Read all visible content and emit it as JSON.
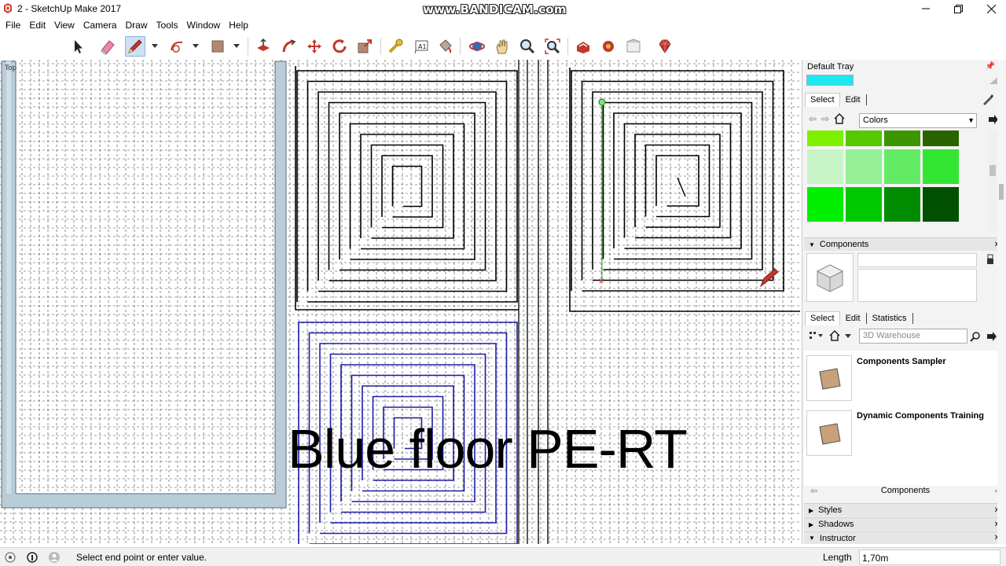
{
  "window": {
    "title": "2 - SketchUp Make 2017",
    "watermark": "www.BANDICAM.com",
    "app_icon": "sketchup-logo-icon",
    "controls": [
      "minimize-icon",
      "restore-icon",
      "close-icon"
    ]
  },
  "menu": {
    "items": [
      "File",
      "Edit",
      "View",
      "Camera",
      "Draw",
      "Tools",
      "Window",
      "Help"
    ]
  },
  "toolbar": {
    "tools": [
      "select-arrow-icon",
      "eraser-icon",
      "pencil-line-icon",
      "arc-icon",
      "rectangle-icon",
      "push-pull-icon",
      "follow-me-icon",
      "move-icon",
      "rotate-icon",
      "scale-icon",
      "tape-measure-icon",
      "text-icon",
      "paint-bucket-icon",
      "orbit-icon",
      "pan-icon",
      "zoom-icon",
      "zoom-extents-icon",
      "3d-warehouse-icon",
      "extension-warehouse-icon",
      "layout-icon",
      "ruby-extension-icon"
    ],
    "active_tool": "pencil-line-icon"
  },
  "canvas": {
    "overlay_text": "Blue floor PE-RT",
    "view_label": "Top",
    "inference_point_color": "#2e9c2e",
    "endpoint_marker_color": "#e04040",
    "blue_pipe_color": "#1c1ca8",
    "grid_color": "#3a3a3a"
  },
  "tray": {
    "title": "Default Tray",
    "materials": {
      "current_color": "#20e8f0",
      "tabs": [
        "Select",
        "Edit"
      ],
      "active_tab": "Select",
      "library": "Colors",
      "swatches": [
        [
          "#7df000",
          "#55c800",
          "#3c9600",
          "#2a6400"
        ],
        [
          "#c8f5c8",
          "#96f096",
          "#64eb64",
          "#32e632"
        ],
        [
          "#00f000",
          "#00c800",
          "#008c00",
          "#005000"
        ]
      ]
    },
    "components": {
      "header": "Components",
      "tabs": [
        "Select",
        "Edit",
        "Statistics"
      ],
      "active_tab": "Select",
      "search_placeholder": "3D Warehouse",
      "items": [
        {
          "name": "Components Sampler"
        },
        {
          "name": "Dynamic Components Training"
        }
      ],
      "footer": "Components"
    },
    "collapsed_sections": [
      "Styles",
      "Shadows"
    ],
    "expanded_section": "Instructor"
  },
  "status": {
    "message": "Select end point or enter value.",
    "measure_label": "Length",
    "measure_value": "1,70m",
    "icons": [
      "geo-location-icon",
      "credits-icon",
      "user-account-icon"
    ]
  }
}
